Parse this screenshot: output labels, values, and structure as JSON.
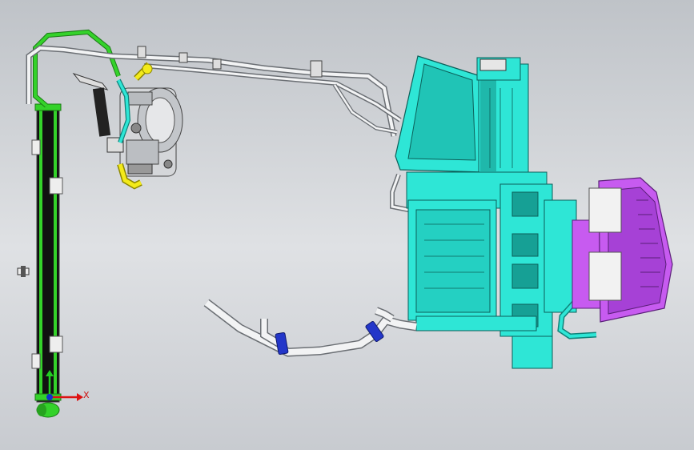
{
  "viewport": {
    "background_top": "#bfc3c8",
    "background_bottom": "#c8cbd0"
  },
  "triad": {
    "x_label": "X",
    "x_color": "#dd1111",
    "y_color": "#22cc22",
    "z_color": "#1133cc"
  },
  "colors": {
    "hvac_housing": "#2ee6d6",
    "hvac_shadow": "#169e94",
    "blower_housing": "#c75bf0",
    "blower_shadow": "#8a2fb8",
    "pipe_white": "#f2f3f4",
    "pipe_outline": "#6b6f74",
    "pipe_green": "#34d22a",
    "fitting_yellow": "#f3ea1a",
    "clamp_blue": "#2336c9",
    "condenser_dark": "#1a1a1a",
    "compressor_gray": "#d4d6d9"
  },
  "components": [
    "condenser-radiator",
    "ac-compressor",
    "hvac-evaporator-housing",
    "blower-motor-housing",
    "suction-line",
    "discharge-line",
    "heater-hose"
  ]
}
